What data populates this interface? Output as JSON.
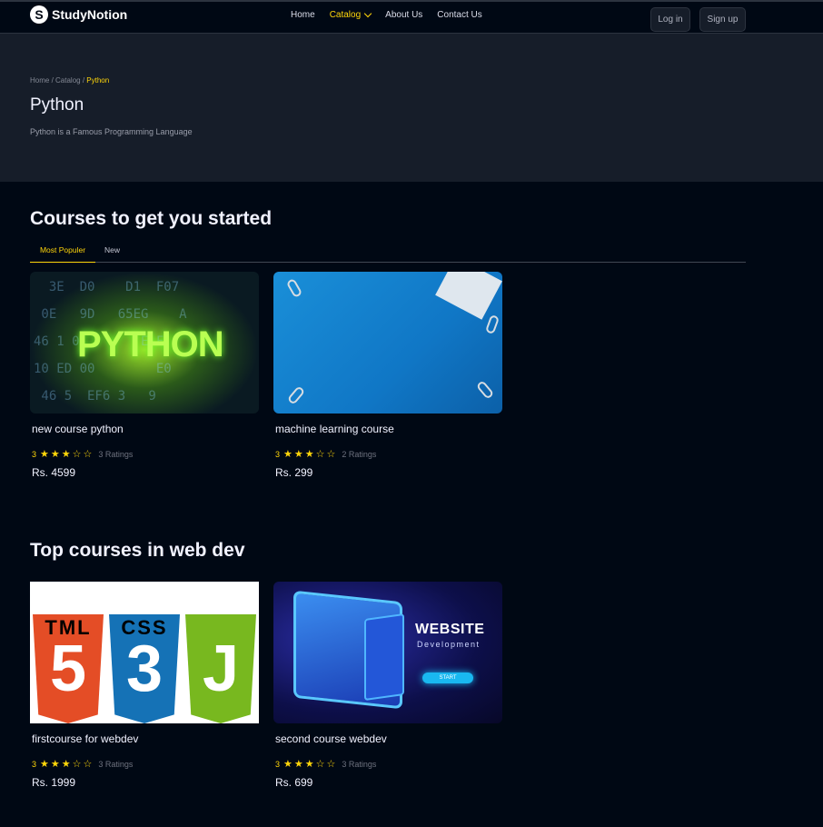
{
  "nav": {
    "logo_glyph": "S",
    "logo_text": "StudyNotion",
    "links": [
      "Home",
      "Catalog",
      "About Us",
      "Contact Us"
    ],
    "active_link": "Catalog",
    "login_label": "Log in",
    "signup_label": "Sign up"
  },
  "hero": {
    "breadcrumb": [
      "Home",
      "Catalog",
      "Python"
    ],
    "breadcrumb_sep": " / ",
    "title": "Python",
    "description": "Python is a Famous Programming Language"
  },
  "section1": {
    "title": "Courses to get you started",
    "tabs": [
      "Most Populer",
      "New"
    ],
    "active_tab": "Most Populer",
    "courses": [
      {
        "title": "new course python",
        "rating": "3",
        "ratings_label": "3 Ratings",
        "stars": 3,
        "price": "Rs. 4599"
      },
      {
        "title": "machine learning course",
        "rating": "3",
        "ratings_label": "2 Ratings",
        "stars": 3,
        "price": "Rs. 299"
      }
    ]
  },
  "section2": {
    "title": "Top courses in web dev",
    "courses": [
      {
        "title": "firstcourse for webdev",
        "rating": "3",
        "ratings_label": "3 Ratings",
        "stars": 3,
        "price": "Rs. 1999"
      },
      {
        "title": "second course webdev",
        "rating": "3",
        "ratings_label": "3 Ratings",
        "stars": 3,
        "price": "Rs. 699"
      }
    ]
  },
  "thumbnails": {
    "python_word": "PYTHON",
    "web_word": "WEBSITE",
    "web_sub": "Development",
    "web_start": "START",
    "badge_html": "5",
    "badge_css": "3",
    "badge_js": "J",
    "badge_html_top": "TML",
    "badge_css_top": "CSS"
  },
  "colors": {
    "accent": "#FFD60A",
    "bg": "#000814",
    "hero_bg": "#161D29"
  }
}
